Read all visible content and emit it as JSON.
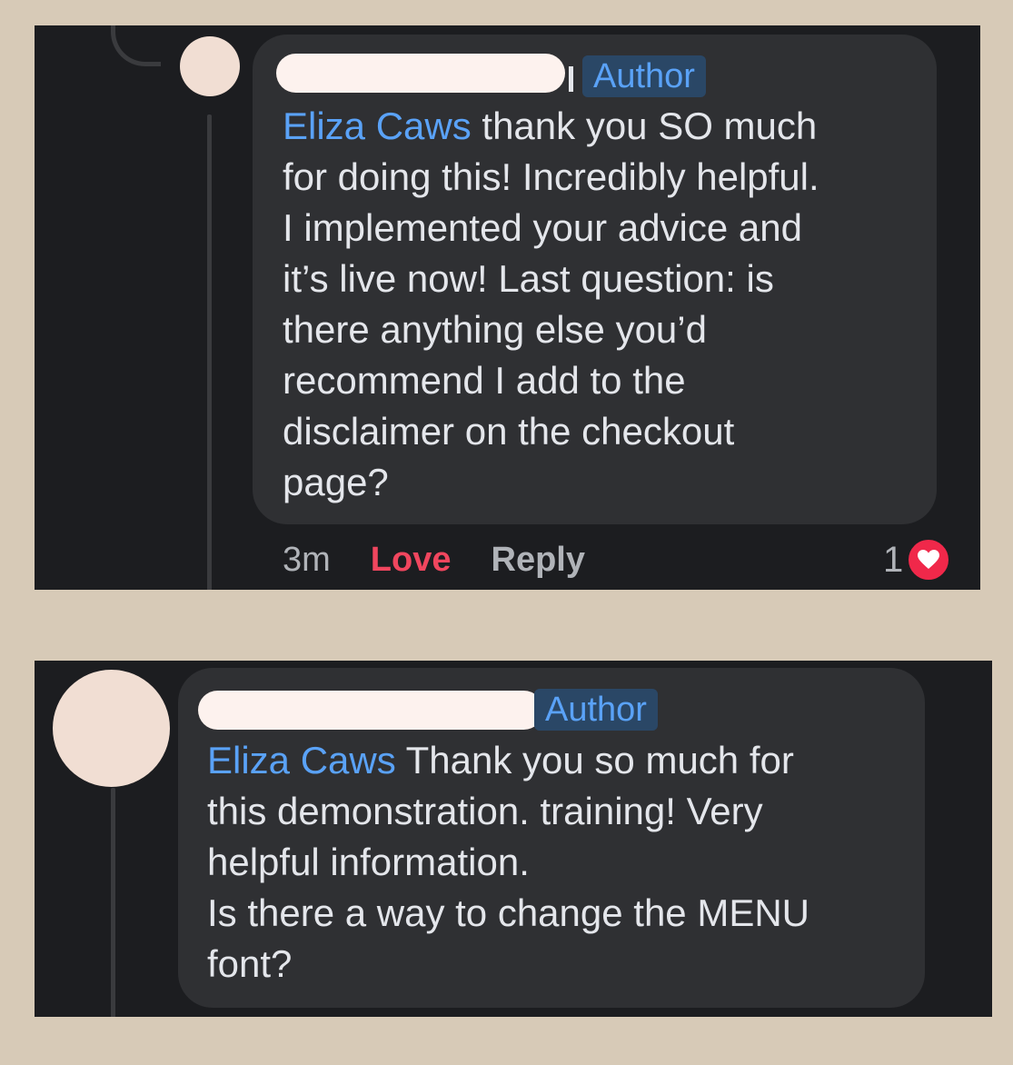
{
  "comments": [
    {
      "author_badge": "Author",
      "mention": "Eliza Caws",
      "text": " thank you SO much\nfor doing this! Incredibly helpful.\nI implemented your advice and\nit’s live now! Last question: is\nthere anything else you’d\nrecommend I add to the\ndisclaimer on the checkout\npage?",
      "time": "3m",
      "love_label": "Love",
      "reply_label": "Reply",
      "reaction_count": "1",
      "reaction_icon": "heart-icon"
    },
    {
      "author_badge": "Author",
      "mention": "Eliza Caws",
      "text": " Thank you so much for\nthis demonstration. training! Very\nhelpful information.\nIs there a way to change the MENU\nfont?"
    }
  ],
  "colors": {
    "background": "#d7cab7",
    "panel": "#1c1d20",
    "bubble": "#2f3033",
    "mention": "#5aa2f7",
    "love": "#f0465e",
    "reaction": "#f0284a"
  }
}
